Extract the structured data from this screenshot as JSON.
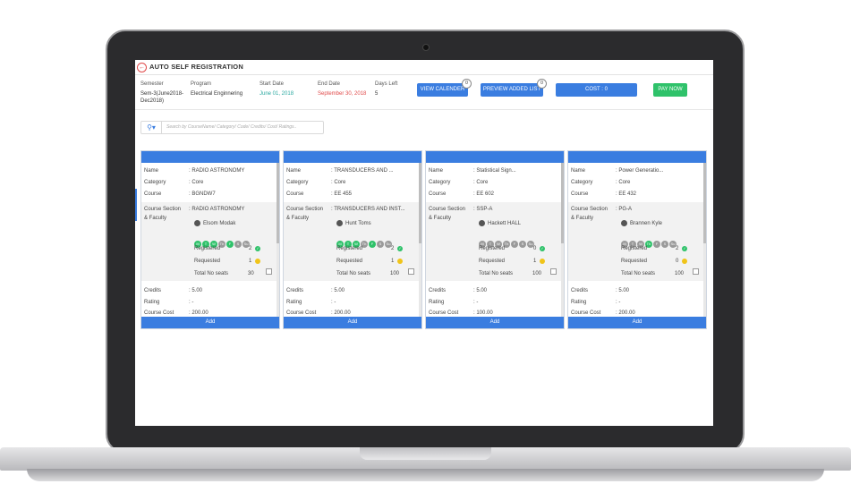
{
  "app": {
    "title": "AUTO SELF REGISTRATION",
    "back_icon": "back-arrow-icon"
  },
  "info": {
    "semester_label": "Semester",
    "semester_value": "Sem-3(June2018-Dec2018)",
    "program_label": "Program",
    "program_value": "Electrical Enginnering",
    "start_label": "Start Date",
    "start_value": "June 01, 2018",
    "end_label": "End Date",
    "end_value": "September 30, 2018",
    "days_label": "Days Left",
    "days_value": "5",
    "start_color": "#2aa8a0",
    "end_color": "#e04a4a"
  },
  "buttons": {
    "view_calendar": "VIEW CALENDER",
    "view_calendar_badge": "0",
    "preview_added": "PREVIEW ADDED LIST",
    "preview_added_badge": "0",
    "cost": "COST : 0",
    "pay_now": "PAY NOW"
  },
  "search": {
    "placeholder": "Search by CourseName/ Category/ Code/ Credits/ Cost/ Ratings..",
    "icon": "search-icon"
  },
  "labels": {
    "name": "Name",
    "category": "Category",
    "course": "Course",
    "section_1": "Course Section",
    "section_2": "& Faculty",
    "registered": "Registered",
    "requested": "Requested",
    "total_seats": "Total No seats",
    "credits": "Credits",
    "rating": "Rating",
    "cost": "Course Cost",
    "add": "Add"
  },
  "days": [
    "M",
    "T",
    "W",
    "Th",
    "F",
    "S",
    "Su"
  ],
  "cards": [
    {
      "name": ": RADIO ASTRONOMY",
      "category": ": Core",
      "course": ": BGNDW7",
      "section": ": RADIO ASTRONOMY",
      "faculty": "Elsom Modak",
      "registered": "2",
      "requested": "1",
      "seats": "30",
      "credits": ": 5.00",
      "rating": ": -",
      "cost": ": 200.00",
      "active_days": [
        "M",
        "T",
        "W",
        "F"
      ]
    },
    {
      "name": ": TRANSDUCERS AND ...",
      "category": ": Core",
      "course": ": EE 455",
      "section": ": TRANSDUCERS AND INST...",
      "faculty": "Hunt Toms",
      "registered": "2",
      "requested": "1",
      "seats": "100",
      "credits": ": 5.00",
      "rating": ": -",
      "cost": ": 200.00",
      "active_days": [
        "M",
        "T",
        "W",
        "F"
      ]
    },
    {
      "name": ": Statistical Sign...",
      "category": ": Core",
      "course": ": EE 602",
      "section": ": SSP-A",
      "faculty": "Hackett HALL",
      "registered": "0",
      "requested": "1",
      "seats": "100",
      "credits": ": 5.00",
      "rating": ": -",
      "cost": ": 100.00",
      "active_days": []
    },
    {
      "name": ": Power Generatio...",
      "category": ": Core",
      "course": ": EE 432",
      "section": ": PG-A",
      "faculty": "Brannen Kyle",
      "registered": "2",
      "requested": "0",
      "seats": "100",
      "credits": ": 5.00",
      "rating": ": -",
      "cost": ": 200.00",
      "active_days": [
        "Th"
      ]
    }
  ]
}
